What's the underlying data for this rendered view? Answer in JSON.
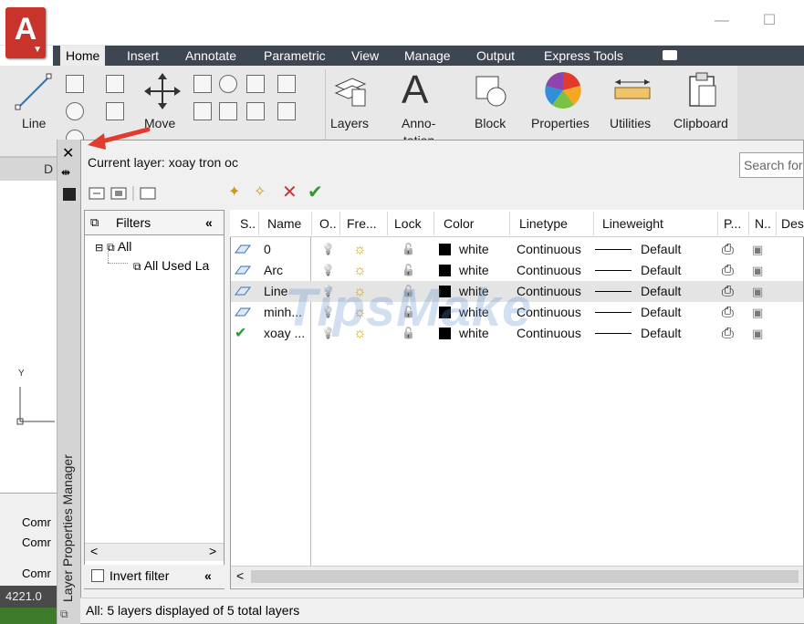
{
  "ribbon": {
    "tabs": [
      "Home",
      "Insert",
      "Annotate",
      "Parametric",
      "View",
      "Manage",
      "Output",
      "Express Tools"
    ],
    "active_tab": "Home",
    "panels": {
      "line": "Line",
      "move": "Move",
      "layers": "Layers",
      "annotation": "Anno-",
      "annotation2": "tation",
      "block": "Block",
      "properties": "Properties",
      "utilities": "Utilities",
      "clipboard": "Clipboard"
    },
    "panel_bar_label": "D"
  },
  "drawing": {
    "ucs_y": "Y",
    "command_lines": [
      "Comr",
      "Comr",
      "Comr"
    ],
    "coords": "4221.0"
  },
  "palette": {
    "title": "Layer Properties Manager",
    "current_layer": "Current layer: xoay tron oc",
    "search_placeholder": "Search for",
    "filters": {
      "header": "Filters",
      "collapse": "«",
      "tree": [
        "All",
        "All Used La"
      ],
      "invert_label": "Invert filter"
    },
    "columns": [
      "S..",
      "Name",
      "O..",
      "Fre...",
      "Lock",
      "Color",
      "Linetype",
      "Lineweight",
      "P...",
      "N..",
      "Des"
    ],
    "layers": [
      {
        "name": "0",
        "color": "white",
        "linetype": "Continuous",
        "lineweight": "Default"
      },
      {
        "name": "Arc",
        "color": "white",
        "linetype": "Continuous",
        "lineweight": "Default"
      },
      {
        "name": "Line",
        "color": "white",
        "linetype": "Continuous",
        "lineweight": "Default"
      },
      {
        "name": "minh...",
        "color": "white",
        "linetype": "Continuous",
        "lineweight": "Default"
      },
      {
        "name": "xoay ...",
        "color": "white",
        "linetype": "Continuous",
        "lineweight": "Default"
      }
    ],
    "current_row_index": 4,
    "selected_row_index": 2,
    "status": "All: 5 layers displayed of 5 total layers"
  },
  "watermark": "TipsMake",
  "colors": {
    "ribbon_tab_bg": "#3e4652",
    "app_red": "#c8332b",
    "check_green": "#2e9a2e",
    "delete_red": "#d23030",
    "arrow_red": "#e23b2e"
  }
}
